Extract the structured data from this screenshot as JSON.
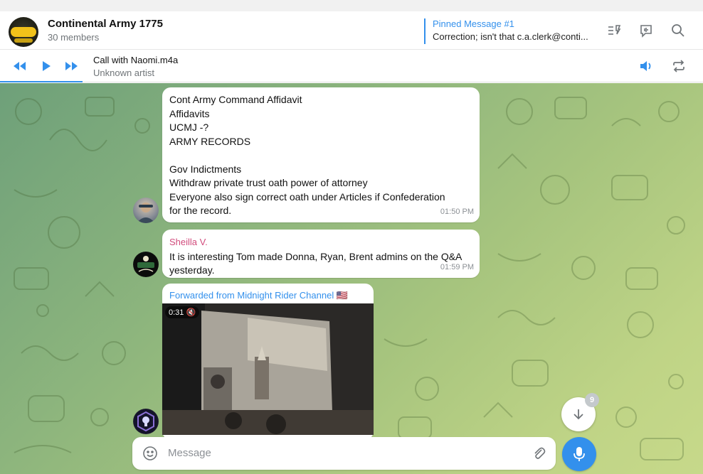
{
  "header": {
    "title": "Continental Army 1775",
    "subtitle": "30 members",
    "avatar_text": "Continental Army",
    "pinned_title": "Pinned Message #1",
    "pinned_text": "Correction; isn't that c.a.clerk@conti..."
  },
  "player": {
    "track_title": "Call with Naomi.m4a",
    "track_artist": "Unknown artist",
    "progress": 0.117
  },
  "messages": [
    {
      "lines": [
        "Cont Army Command Affidavit",
        "Affidavits",
        "UCMJ -?",
        "ARMY RECORDS",
        "",
        "Gov Indictments",
        "Withdraw private trust oath power of attorney",
        "Everyone also sign correct oath under Articles if Confederation",
        "for the record."
      ],
      "time": "01:50 PM"
    },
    {
      "sender": "Sheilla V.",
      "lines": [
        "It is interesting Tom made Donna, Ryan, Brent admins on the Q&A",
        "yesterday."
      ],
      "time": "01:59 PM"
    },
    {
      "forwarded": "Forwarded from Midnight Rider Channel 🇺🇸",
      "video_duration": "0:31"
    }
  ],
  "scroll_badge": "9",
  "composer": {
    "placeholder": "Message"
  },
  "colors": {
    "accent": "#3390ec",
    "sender": "#d14b7c",
    "chat_bg_start": "#6ea07a",
    "chat_bg_end": "#c7d98a"
  }
}
